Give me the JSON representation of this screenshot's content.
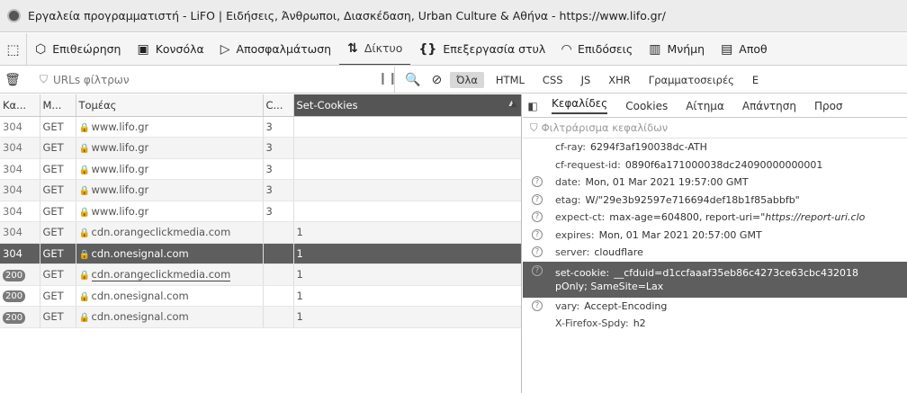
{
  "window": {
    "title": "Εργαλεία προγραμματιστή - LiFO | Ειδήσεις, Άνθρωποι, Διασκέδαση, Urban Culture & Αθήνα - https://www.lifo.gr/"
  },
  "toolbar": {
    "tabs": [
      {
        "icon": "⬡",
        "label": "Επιθεώρηση"
      },
      {
        "icon": "▣",
        "label": "Κονσόλα"
      },
      {
        "icon": "▷",
        "label": "Αποσφαλμάτωση"
      },
      {
        "icon": "⇅",
        "label": "Δίκτυο"
      },
      {
        "icon": "{}",
        "label": "Επεξεργασία στυλ"
      },
      {
        "icon": "◠",
        "label": "Επιδόσεις"
      },
      {
        "icon": "▥",
        "label": "Μνήμη"
      },
      {
        "icon": "▤",
        "label": "Αποθ"
      }
    ]
  },
  "filter": {
    "placeholder": "URLs φίλτρων",
    "types": [
      "Όλα",
      "HTML",
      "CSS",
      "JS",
      "XHR",
      "Γραμματοσειρές",
      "E"
    ]
  },
  "table": {
    "headers": [
      "Κα...",
      "Μ...",
      "Τομέας",
      "C...",
      "Set-Cookies"
    ],
    "rows": [
      {
        "status": "304",
        "method": "GET",
        "domain": "www.lifo.gr",
        "c": "3",
        "cookies": ""
      },
      {
        "status": "304",
        "method": "GET",
        "domain": "www.lifo.gr",
        "c": "3",
        "cookies": ""
      },
      {
        "status": "304",
        "method": "GET",
        "domain": "www.lifo.gr",
        "c": "3",
        "cookies": ""
      },
      {
        "status": "304",
        "method": "GET",
        "domain": "www.lifo.gr",
        "c": "3",
        "cookies": ""
      },
      {
        "status": "304",
        "method": "GET",
        "domain": "www.lifo.gr",
        "c": "3",
        "cookies": ""
      },
      {
        "status": "304",
        "method": "GET",
        "domain": "cdn.orangeclickmedia.com",
        "c": "",
        "cookies": "1"
      },
      {
        "status": "304",
        "method": "GET",
        "domain": "cdn.onesignal.com",
        "c": "",
        "cookies": "1"
      },
      {
        "status": "200",
        "method": "GET",
        "domain": "cdn.orangeclickmedia.com",
        "c": "",
        "cookies": "1"
      },
      {
        "status": "200",
        "method": "GET",
        "domain": "cdn.onesignal.com",
        "c": "",
        "cookies": "1"
      },
      {
        "status": "200",
        "method": "GET",
        "domain": "cdn.onesignal.com",
        "c": "",
        "cookies": "1"
      }
    ]
  },
  "details": {
    "tabs": [
      "Κεφαλίδες",
      "Cookies",
      "Αίτημα",
      "Απάντηση",
      "Προσ"
    ],
    "filter_placeholder": "Φιλτράρισμα κεφαλίδων",
    "headers": [
      {
        "name": "cf-ray:",
        "value": "6294f3af190038dc-ATH",
        "help": false
      },
      {
        "name": "cf-request-id:",
        "value": "0890f6a171000038dc24090000000001",
        "help": false
      },
      {
        "name": "date:",
        "value": "Mon, 01 Mar 2021 19:57:00 GMT",
        "help": true
      },
      {
        "name": "etag:",
        "value": "W/\"29e3b92597e716694def18b1f85abbfb\"",
        "help": true
      },
      {
        "name": "expect-ct:",
        "value": "max-age=604800, report-uri=",
        "value_italic": "\"https://report-uri.clo",
        "help": true
      },
      {
        "name": "expires:",
        "value": "Mon, 01 Mar 2021 20:57:00 GMT",
        "help": true
      },
      {
        "name": "server:",
        "value": "cloudflare",
        "help": true
      }
    ],
    "selected_header": {
      "name": "set-cookie:",
      "value": "__cfduid=d1ccfaaaf35eb86c4273ce63cbc432018",
      "value_cont": "pOnly; SameSite=Lax"
    },
    "headers_after": [
      {
        "name": "vary:",
        "value": "Accept-Encoding",
        "help": true
      },
      {
        "name": "X-Firefox-Spdy:",
        "value": "h2",
        "help": false
      }
    ]
  }
}
